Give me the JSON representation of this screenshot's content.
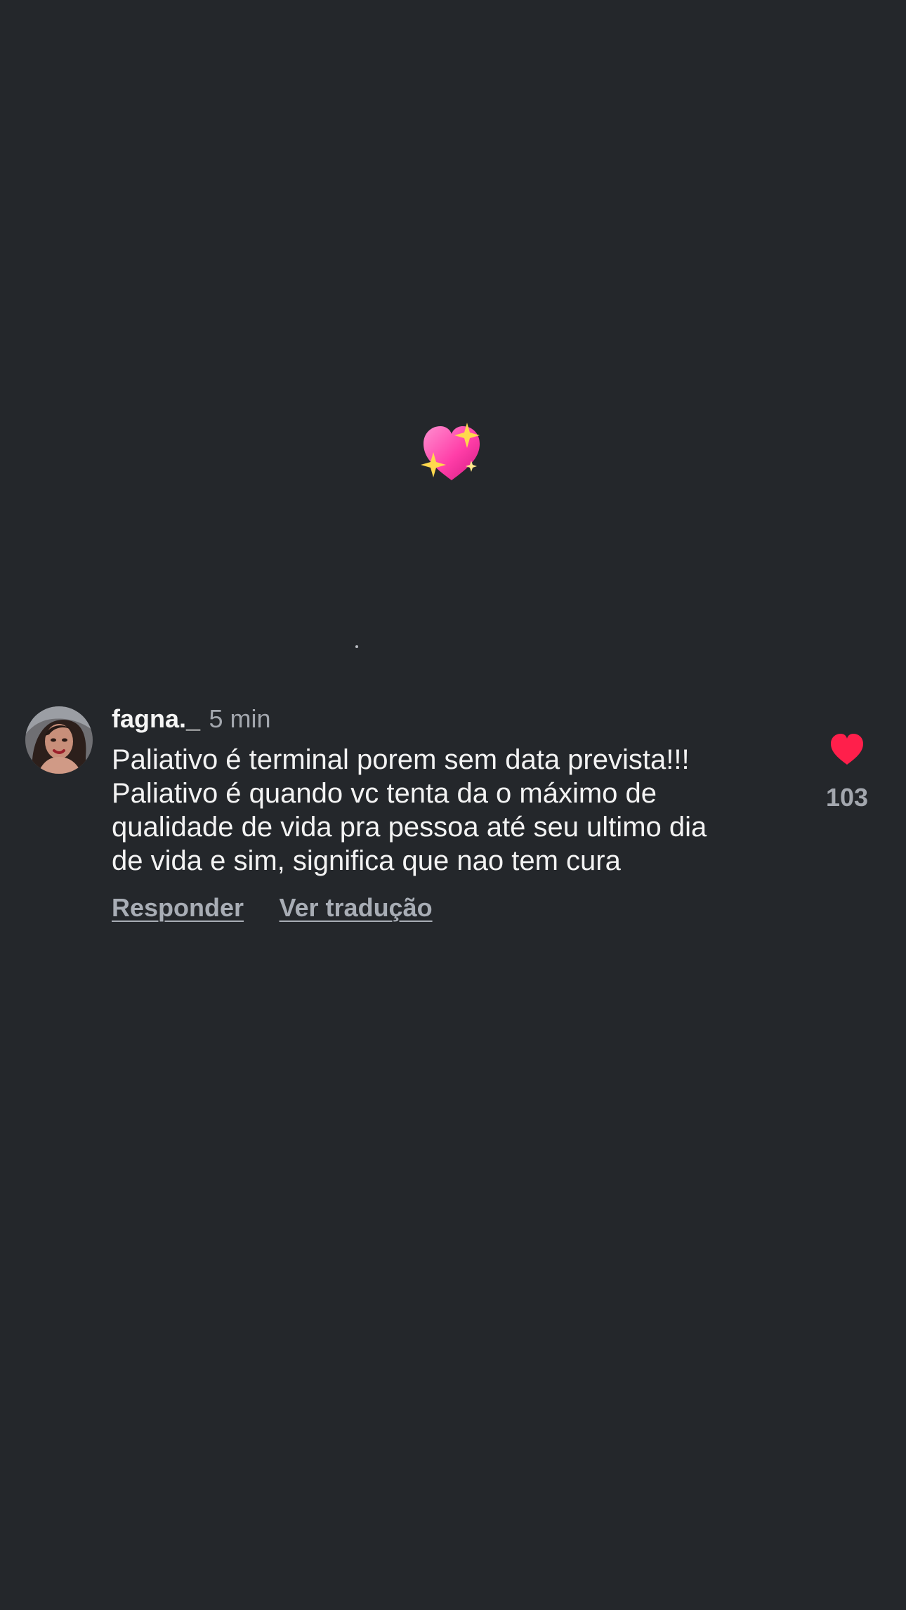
{
  "center_emoji": {
    "name": "sparkling-heart-icon"
  },
  "comment": {
    "username": "fagna._",
    "time": "5 min",
    "text_lines": [
      "Paliativo é terminal porem sem data prevista!!!",
      "Paliativo é quando vc tenta da o máximo de",
      "qualidade de vida pra pessoa até seu ultimo dia",
      "de vida e sim, significa que nao tem cura"
    ],
    "actions": {
      "reply": "Responder",
      "translate": "Ver tradução"
    },
    "likes": {
      "count": "103",
      "icon": "heart-icon",
      "color": "#ff1f4b"
    }
  }
}
